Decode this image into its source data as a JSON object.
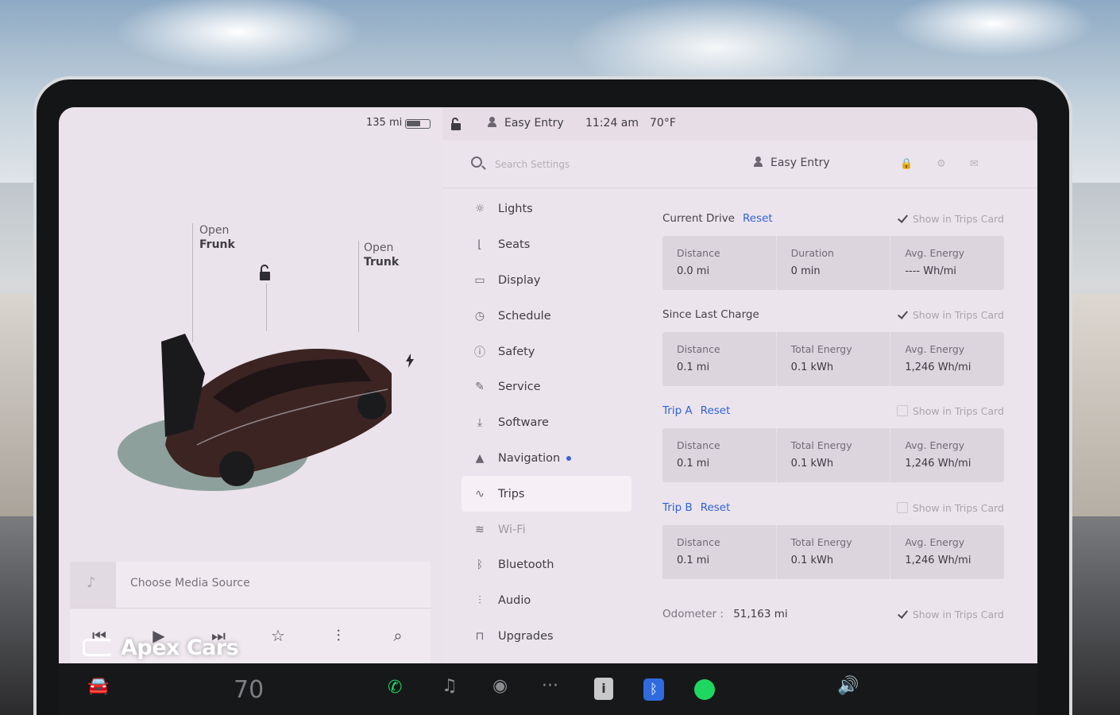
{
  "status_bar": {
    "range": "135 mi",
    "battery_level": 0.6,
    "profile": "Easy Entry",
    "time": "11:24 am",
    "temperature": "70°F"
  },
  "car_panel": {
    "frunk": {
      "line1": "Open",
      "line2": "Frunk"
    },
    "trunk": {
      "line1": "Open",
      "line2": "Trunk"
    }
  },
  "media": {
    "source_label": "Choose Media Source",
    "controls": [
      "previous-icon",
      "play-icon",
      "next-icon",
      "star-icon",
      "equalizer-icon",
      "search-icon"
    ]
  },
  "watermark": "Apex Cars",
  "settings": {
    "search_placeholder": "Search Settings",
    "profile": "Easy Entry",
    "menu": [
      {
        "label": "Lights",
        "icon": "light-icon"
      },
      {
        "label": "Seats",
        "icon": "seat-icon"
      },
      {
        "label": "Display",
        "icon": "display-icon"
      },
      {
        "label": "Schedule",
        "icon": "clock-icon"
      },
      {
        "label": "Safety",
        "icon": "alert-icon"
      },
      {
        "label": "Service",
        "icon": "wrench-icon"
      },
      {
        "label": "Software",
        "icon": "download-icon"
      },
      {
        "label": "Navigation",
        "icon": "navigation-icon",
        "dot": true
      },
      {
        "label": "Trips",
        "icon": "trips-icon",
        "active": true
      },
      {
        "label": "Wi-Fi",
        "icon": "wifi-icon",
        "dim": true
      },
      {
        "label": "Bluetooth",
        "icon": "bluetooth-icon"
      },
      {
        "label": "Audio",
        "icon": "audio-icon"
      },
      {
        "label": "Upgrades",
        "icon": "lock-icon"
      }
    ],
    "trips": {
      "show_label": "Show in Trips Card",
      "reset_label": "Reset",
      "current_drive": {
        "title": "Current Drive",
        "show_checked": true,
        "distance_label": "Distance",
        "distance": "0.0  mi",
        "duration_label": "Duration",
        "duration": "0  min",
        "avg_label": "Avg. Energy",
        "avg": "----  Wh/mi"
      },
      "since_last_charge": {
        "title": "Since Last Charge",
        "show_checked": true,
        "distance_label": "Distance",
        "distance": "0.1  mi",
        "energy_label": "Total Energy",
        "energy": "0.1  kWh",
        "avg_label": "Avg. Energy",
        "avg": "1,246  Wh/mi"
      },
      "trip_a": {
        "title": "Trip A",
        "show_checked": false,
        "distance_label": "Distance",
        "distance": "0.1  mi",
        "energy_label": "Total Energy",
        "energy": "0.1  kWh",
        "avg_label": "Avg. Energy",
        "avg": "1,246  Wh/mi"
      },
      "trip_b": {
        "title": "Trip B",
        "show_checked": false,
        "distance_label": "Distance",
        "distance": "0.1  mi",
        "energy_label": "Total Energy",
        "energy": "0.1  kWh",
        "avg_label": "Avg. Energy",
        "avg": "1,246  Wh/mi"
      },
      "odometer_label": "Odometer  :",
      "odometer": "51,163  mi",
      "odometer_show_checked": true
    }
  },
  "taskbar": {
    "temperature": "70",
    "icons": [
      "car-icon",
      "phone-icon",
      "music-icon",
      "camera-icon",
      "more-icon",
      "info-icon",
      "bluetooth-icon",
      "spotify-icon",
      "volume-icon"
    ]
  }
}
